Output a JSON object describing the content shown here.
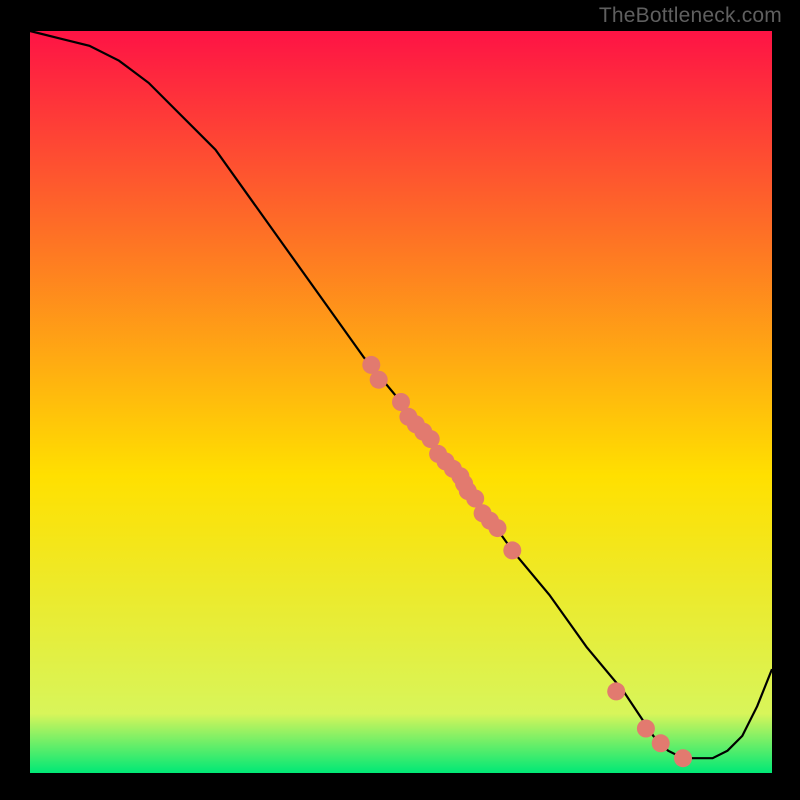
{
  "attribution": "TheBottleneck.com",
  "chart_data": {
    "type": "line",
    "title": "",
    "xlabel": "",
    "ylabel": "",
    "xlim": [
      0,
      100
    ],
    "ylim": [
      0,
      100
    ],
    "grid": false,
    "legend": false,
    "background_gradient": {
      "start": "#fe1345",
      "mid": "#ffe000",
      "end": "#00e876"
    },
    "curve": {
      "name": "bottleneck-curve",
      "x": [
        0,
        4,
        8,
        12,
        16,
        20,
        25,
        30,
        35,
        40,
        45,
        50,
        55,
        60,
        65,
        70,
        75,
        80,
        82,
        84,
        86,
        88,
        90,
        92,
        94,
        96,
        98,
        100
      ],
      "y": [
        100,
        99,
        98,
        96,
        93,
        89,
        84,
        77,
        70,
        63,
        56,
        50,
        43,
        37,
        30,
        24,
        17,
        11,
        8,
        5,
        3,
        2,
        2,
        2,
        3,
        5,
        9,
        14
      ]
    },
    "points": {
      "name": "sample-points",
      "color": "#e27a6f",
      "x": [
        46,
        47,
        50,
        51,
        52,
        53,
        54,
        55,
        56,
        57,
        58,
        58.5,
        59,
        60,
        61,
        62,
        63,
        65,
        79,
        83,
        85,
        88
      ],
      "y": [
        55,
        53,
        50,
        48,
        47,
        46,
        45,
        43,
        42,
        41,
        40,
        39,
        38,
        37,
        35,
        34,
        33,
        30,
        11,
        6,
        4,
        2
      ]
    }
  }
}
